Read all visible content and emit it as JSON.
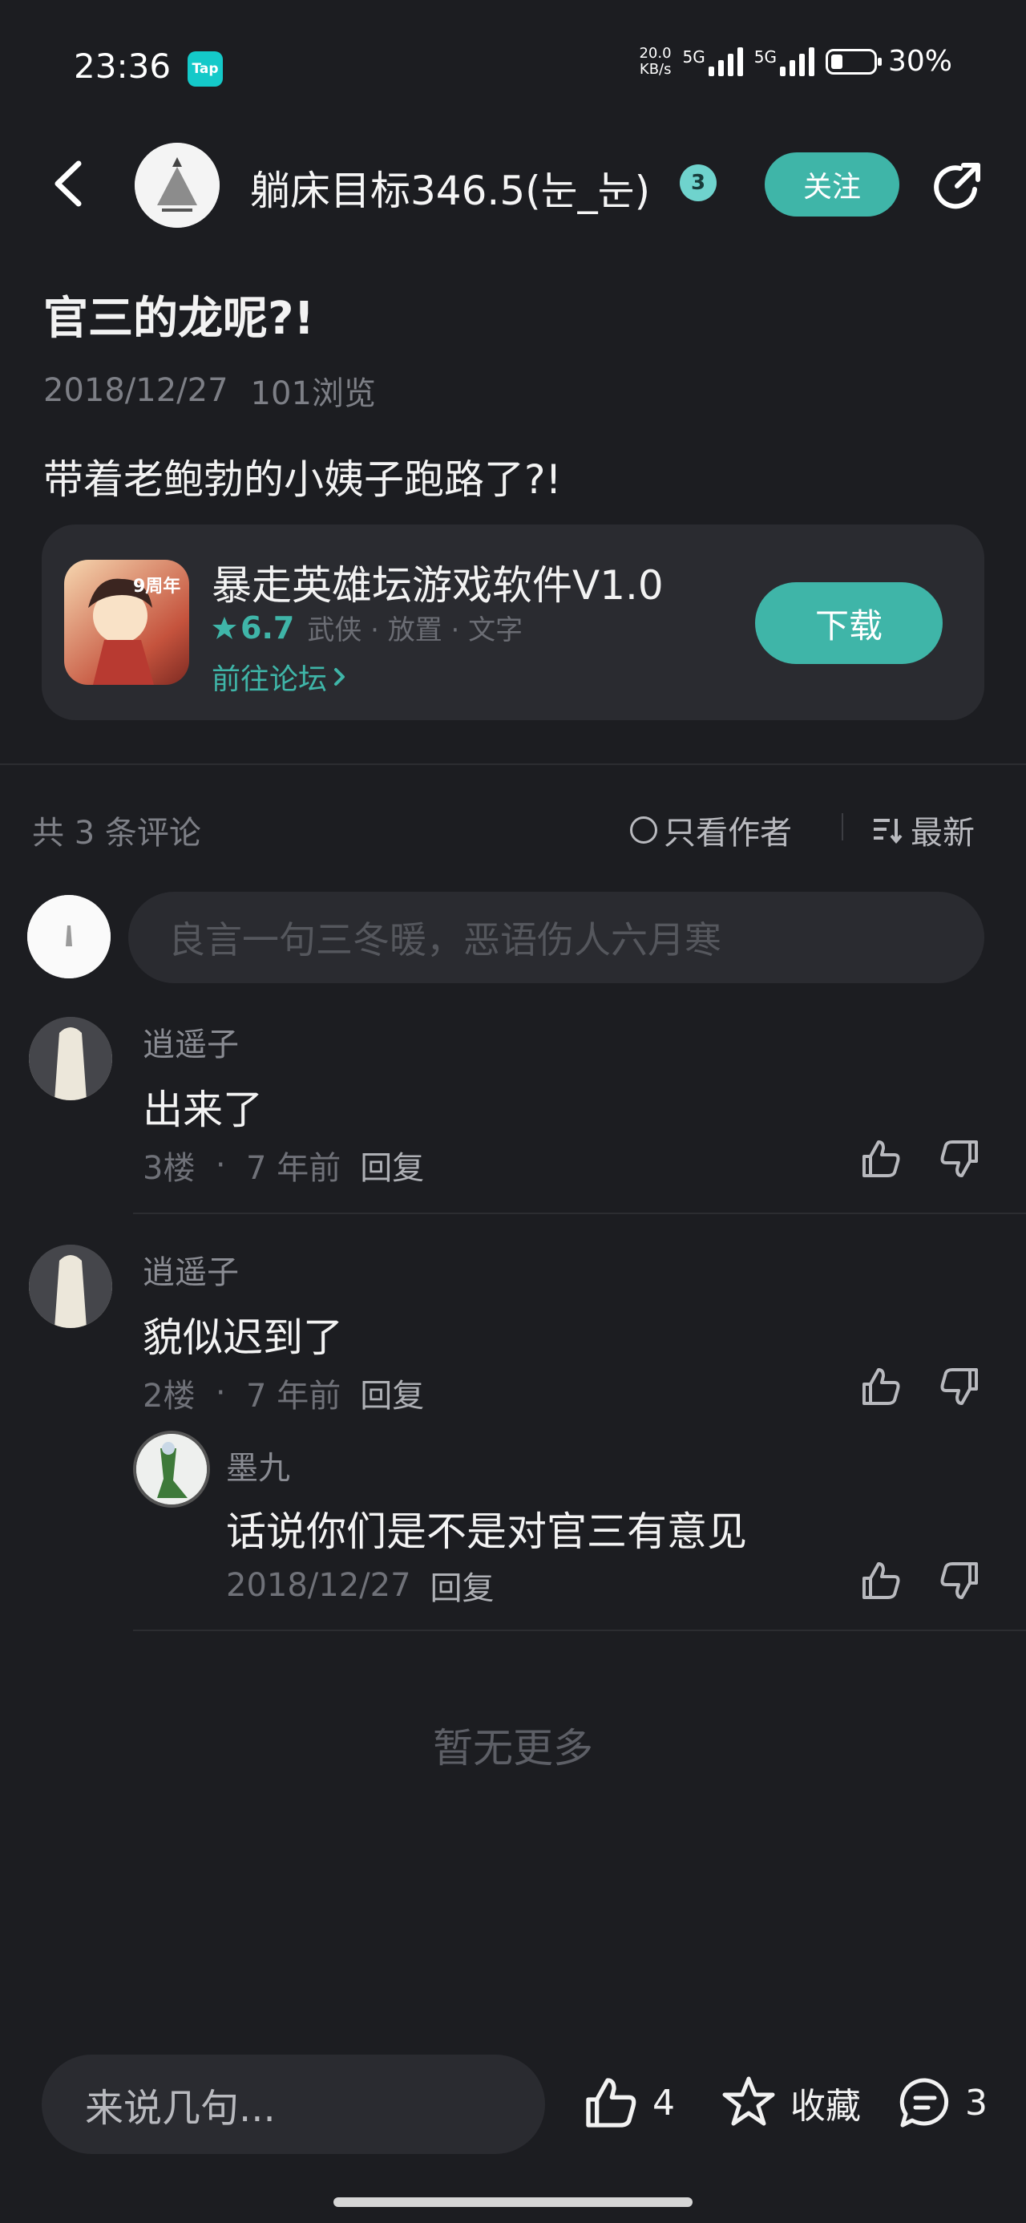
{
  "status_bar": {
    "time": "23:36",
    "app_badge": "Tap",
    "net_speed_value": "20.0",
    "net_speed_unit": "KB/s",
    "network_1": "5G",
    "network_2": "5G",
    "battery": "30%",
    "battery_level": 0.3
  },
  "header": {
    "author_name": "躺床目标346.5(눈_눈)",
    "level_badge": "3",
    "follow_label": "关注"
  },
  "post": {
    "title": "官三的龙呢?!",
    "date": "2018/12/27",
    "views": "101浏览",
    "body": "带着老鲍勃的小姨子跑路了?!"
  },
  "game_card": {
    "name": "暴走英雄坛游戏软件V1.0",
    "icon_text": "9周年",
    "rating": "6.7",
    "tags": "武侠 · 放置 · 文字",
    "forum_link": "前往论坛",
    "download_label": "下载"
  },
  "comments_header": {
    "count_label": "共 3 条评论",
    "author_only": "只看作者",
    "sort": "最新"
  },
  "comment_input": {
    "placeholder": "良言一句三冬暖，恶语伤人六月寒"
  },
  "comments": [
    {
      "user": "逍遥子",
      "text": "出来了",
      "floor": "3楼",
      "time": "7 年前",
      "reply_label": "回复"
    },
    {
      "user": "逍遥子",
      "text": "貌似迟到了",
      "floor": "2楼",
      "time": "7 年前",
      "reply_label": "回复",
      "replies": [
        {
          "user": "墨九",
          "text": "话说你们是不是对官三有意见",
          "date": "2018/12/27",
          "reply_label": "回复"
        }
      ]
    }
  ],
  "no_more": "暂无更多",
  "bottom_bar": {
    "input_placeholder": "来说几句...",
    "like_count": "4",
    "favorite_label": "收藏",
    "comment_count": "3"
  },
  "icons": {
    "back": "back-arrow-icon",
    "share": "share-icon",
    "star": "star-icon",
    "like": "thumb-up-icon",
    "dislike": "thumb-down-icon",
    "favorite": "star-outline-icon",
    "comment": "comment-bubble-icon",
    "sort": "sort-icon"
  },
  "colors": {
    "background": "#1c1d21",
    "accent": "#3fb5a8",
    "card": "#2a2b30",
    "muted_text": "#7d7f86"
  }
}
